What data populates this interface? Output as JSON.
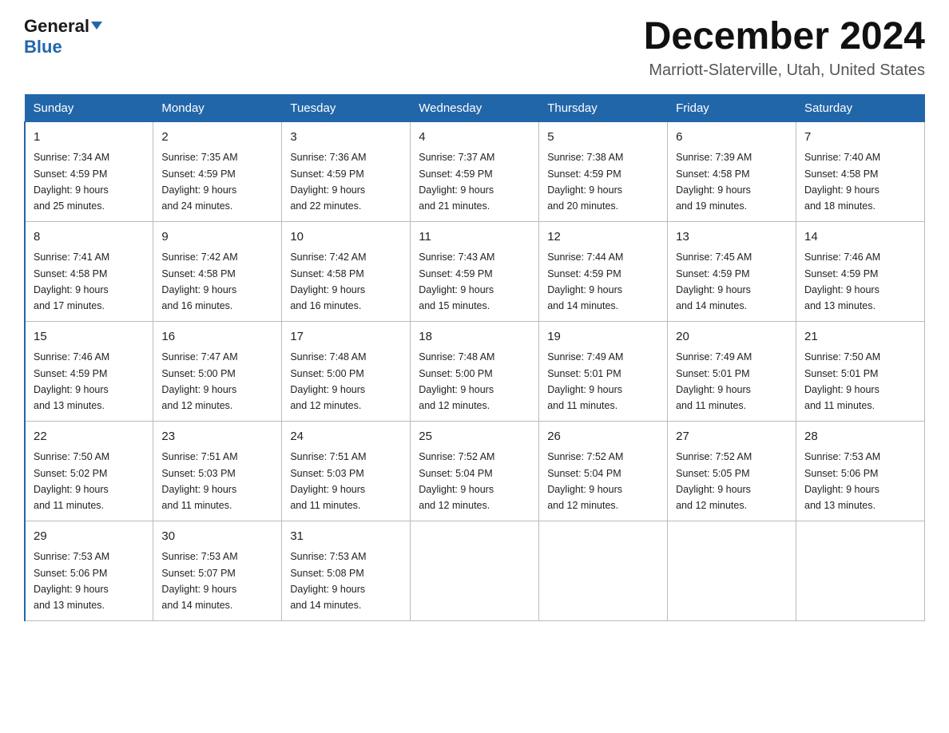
{
  "header": {
    "logo_general": "General",
    "logo_blue": "Blue",
    "month_title": "December 2024",
    "location": "Marriott-Slaterville, Utah, United States"
  },
  "weekdays": [
    "Sunday",
    "Monday",
    "Tuesday",
    "Wednesday",
    "Thursday",
    "Friday",
    "Saturday"
  ],
  "weeks": [
    [
      {
        "day": "1",
        "sunrise": "7:34 AM",
        "sunset": "4:59 PM",
        "daylight": "9 hours and 25 minutes."
      },
      {
        "day": "2",
        "sunrise": "7:35 AM",
        "sunset": "4:59 PM",
        "daylight": "9 hours and 24 minutes."
      },
      {
        "day": "3",
        "sunrise": "7:36 AM",
        "sunset": "4:59 PM",
        "daylight": "9 hours and 22 minutes."
      },
      {
        "day": "4",
        "sunrise": "7:37 AM",
        "sunset": "4:59 PM",
        "daylight": "9 hours and 21 minutes."
      },
      {
        "day": "5",
        "sunrise": "7:38 AM",
        "sunset": "4:59 PM",
        "daylight": "9 hours and 20 minutes."
      },
      {
        "day": "6",
        "sunrise": "7:39 AM",
        "sunset": "4:58 PM",
        "daylight": "9 hours and 19 minutes."
      },
      {
        "day": "7",
        "sunrise": "7:40 AM",
        "sunset": "4:58 PM",
        "daylight": "9 hours and 18 minutes."
      }
    ],
    [
      {
        "day": "8",
        "sunrise": "7:41 AM",
        "sunset": "4:58 PM",
        "daylight": "9 hours and 17 minutes."
      },
      {
        "day": "9",
        "sunrise": "7:42 AM",
        "sunset": "4:58 PM",
        "daylight": "9 hours and 16 minutes."
      },
      {
        "day": "10",
        "sunrise": "7:42 AM",
        "sunset": "4:58 PM",
        "daylight": "9 hours and 16 minutes."
      },
      {
        "day": "11",
        "sunrise": "7:43 AM",
        "sunset": "4:59 PM",
        "daylight": "9 hours and 15 minutes."
      },
      {
        "day": "12",
        "sunrise": "7:44 AM",
        "sunset": "4:59 PM",
        "daylight": "9 hours and 14 minutes."
      },
      {
        "day": "13",
        "sunrise": "7:45 AM",
        "sunset": "4:59 PM",
        "daylight": "9 hours and 14 minutes."
      },
      {
        "day": "14",
        "sunrise": "7:46 AM",
        "sunset": "4:59 PM",
        "daylight": "9 hours and 13 minutes."
      }
    ],
    [
      {
        "day": "15",
        "sunrise": "7:46 AM",
        "sunset": "4:59 PM",
        "daylight": "9 hours and 13 minutes."
      },
      {
        "day": "16",
        "sunrise": "7:47 AM",
        "sunset": "5:00 PM",
        "daylight": "9 hours and 12 minutes."
      },
      {
        "day": "17",
        "sunrise": "7:48 AM",
        "sunset": "5:00 PM",
        "daylight": "9 hours and 12 minutes."
      },
      {
        "day": "18",
        "sunrise": "7:48 AM",
        "sunset": "5:00 PM",
        "daylight": "9 hours and 12 minutes."
      },
      {
        "day": "19",
        "sunrise": "7:49 AM",
        "sunset": "5:01 PM",
        "daylight": "9 hours and 11 minutes."
      },
      {
        "day": "20",
        "sunrise": "7:49 AM",
        "sunset": "5:01 PM",
        "daylight": "9 hours and 11 minutes."
      },
      {
        "day": "21",
        "sunrise": "7:50 AM",
        "sunset": "5:01 PM",
        "daylight": "9 hours and 11 minutes."
      }
    ],
    [
      {
        "day": "22",
        "sunrise": "7:50 AM",
        "sunset": "5:02 PM",
        "daylight": "9 hours and 11 minutes."
      },
      {
        "day": "23",
        "sunrise": "7:51 AM",
        "sunset": "5:03 PM",
        "daylight": "9 hours and 11 minutes."
      },
      {
        "day": "24",
        "sunrise": "7:51 AM",
        "sunset": "5:03 PM",
        "daylight": "9 hours and 11 minutes."
      },
      {
        "day": "25",
        "sunrise": "7:52 AM",
        "sunset": "5:04 PM",
        "daylight": "9 hours and 12 minutes."
      },
      {
        "day": "26",
        "sunrise": "7:52 AM",
        "sunset": "5:04 PM",
        "daylight": "9 hours and 12 minutes."
      },
      {
        "day": "27",
        "sunrise": "7:52 AM",
        "sunset": "5:05 PM",
        "daylight": "9 hours and 12 minutes."
      },
      {
        "day": "28",
        "sunrise": "7:53 AM",
        "sunset": "5:06 PM",
        "daylight": "9 hours and 13 minutes."
      }
    ],
    [
      {
        "day": "29",
        "sunrise": "7:53 AM",
        "sunset": "5:06 PM",
        "daylight": "9 hours and 13 minutes."
      },
      {
        "day": "30",
        "sunrise": "7:53 AM",
        "sunset": "5:07 PM",
        "daylight": "9 hours and 14 minutes."
      },
      {
        "day": "31",
        "sunrise": "7:53 AM",
        "sunset": "5:08 PM",
        "daylight": "9 hours and 14 minutes."
      },
      null,
      null,
      null,
      null
    ]
  ],
  "labels": {
    "sunrise": "Sunrise:",
    "sunset": "Sunset:",
    "daylight": "Daylight:"
  }
}
